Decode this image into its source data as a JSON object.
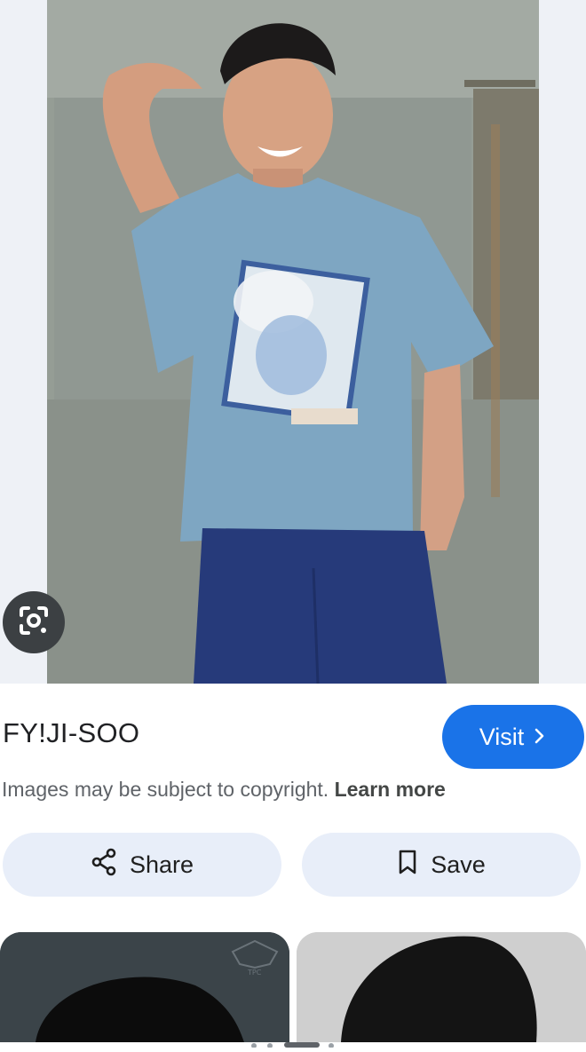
{
  "source": {
    "title": "FY!JI-SOO",
    "visit_label": "Visit"
  },
  "copyright": {
    "text": "Images may be subject to copyright.",
    "learn_more": "Learn more"
  },
  "actions": {
    "share_label": "Share",
    "save_label": "Save"
  },
  "icons": {
    "lens": "google-lens-icon",
    "visit": "chevron-right-icon",
    "share": "share-icon",
    "save": "bookmark-icon"
  },
  "colors": {
    "accent": "#1a73e8",
    "pill_bg": "#e8eef9",
    "lens_bg": "#3c4043"
  },
  "thumbnails": {
    "thumb1_watermark": "TPC"
  }
}
